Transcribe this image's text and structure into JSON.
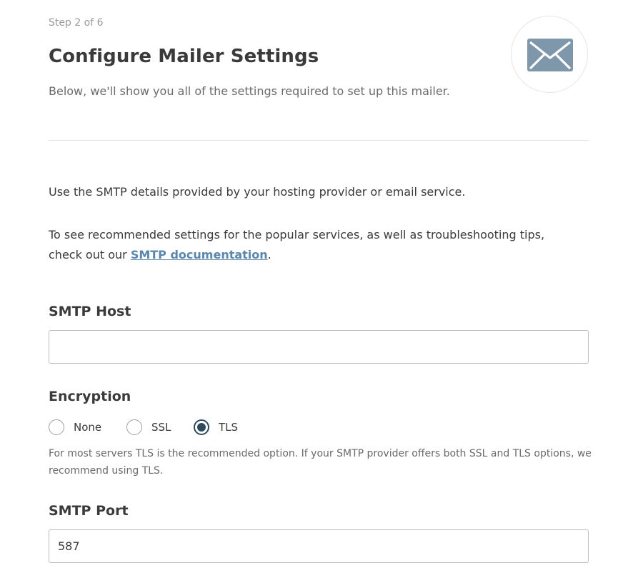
{
  "header": {
    "step": "Step 2 of 6",
    "title": "Configure Mailer Settings",
    "subtitle": "Below, we'll show you all of the settings required to set up this mailer.",
    "icon": "envelope-icon",
    "icon_color": "#7f97aa"
  },
  "intro": {
    "line1": "Use the SMTP details provided by your hosting provider or email service.",
    "line2_before": "To see recommended settings for the popular services, as well as troubleshooting tips, check out our ",
    "link_text": "SMTP documentation",
    "line2_after": "."
  },
  "smtp_host": {
    "label": "SMTP Host",
    "value": ""
  },
  "encryption": {
    "label": "Encryption",
    "options": [
      {
        "label": "None",
        "checked": false
      },
      {
        "label": "SSL",
        "checked": false
      },
      {
        "label": "TLS",
        "checked": true
      }
    ],
    "help": "For most servers TLS is the recommended option. If your SMTP provider offers both SSL and TLS options, we recommend using TLS."
  },
  "smtp_port": {
    "label": "SMTP Port",
    "value": "587"
  },
  "colors": {
    "accent": "#2f4a5c",
    "link": "#5a86ab"
  }
}
